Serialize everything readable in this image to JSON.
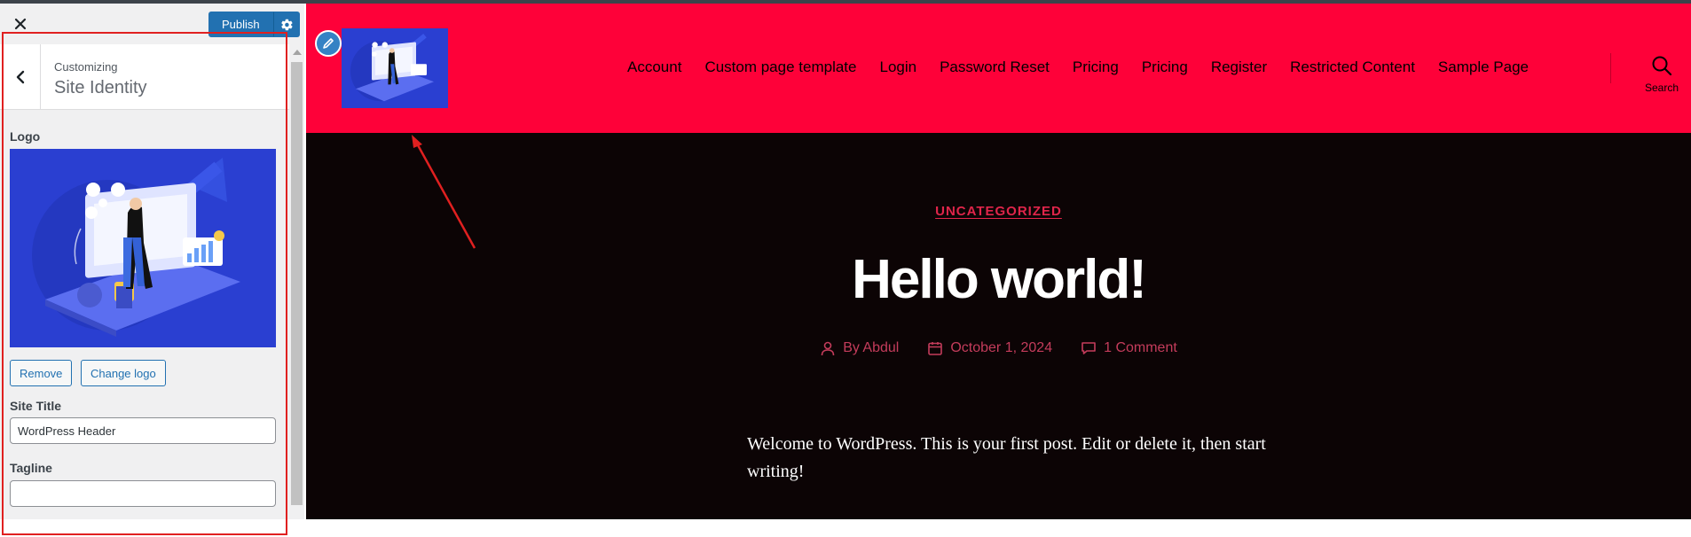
{
  "sidebar": {
    "publish_label": "Publish",
    "customizing_label": "Customizing",
    "section_title": "Site Identity",
    "logo": {
      "label": "Logo",
      "remove_label": "Remove",
      "change_label": "Change logo"
    },
    "site_title": {
      "label": "Site Title",
      "value": "WordPress Header"
    },
    "tagline": {
      "label": "Tagline",
      "value": ""
    }
  },
  "preview": {
    "header_color": "#fe0139",
    "nav_items": [
      "Account",
      "Custom page template",
      "Login",
      "Password Reset",
      "Pricing",
      "Pricing",
      "Register",
      "Restricted Content",
      "Sample Page"
    ],
    "search_label": "Search",
    "post": {
      "category": "UNCATEGORIZED",
      "title": "Hello world!",
      "author": "By Abdul",
      "date": "October 1, 2024",
      "comments": "1 Comment",
      "body": "Welcome to WordPress. This is your first post. Edit or delete it, then start writing!"
    }
  },
  "colors": {
    "accent": "#2271b1",
    "annotation": "#e02020"
  }
}
